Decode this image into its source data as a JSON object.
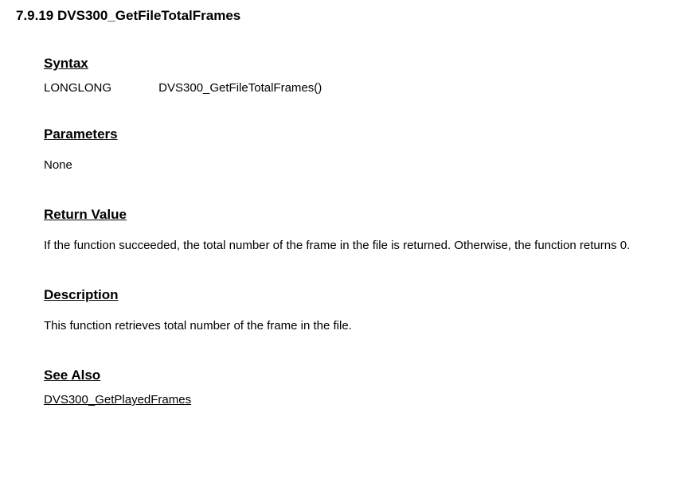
{
  "section": {
    "number": "7.9.19",
    "title": "DVS300_GetFileTotalFrames"
  },
  "syntax": {
    "heading": "Syntax",
    "return_type": "LONGLONG",
    "signature": "DVS300_GetFileTotalFrames()"
  },
  "parameters": {
    "heading": "Parameters",
    "content": "None"
  },
  "return_value": {
    "heading": "Return Value",
    "content": "If the function succeeded, the total number of the frame in the file is returned. Otherwise, the function returns 0."
  },
  "description": {
    "heading": "Description",
    "content": "This function retrieves total number of the frame in the file."
  },
  "see_also": {
    "heading": "See Also",
    "link": "DVS300_GetPlayedFrames"
  }
}
